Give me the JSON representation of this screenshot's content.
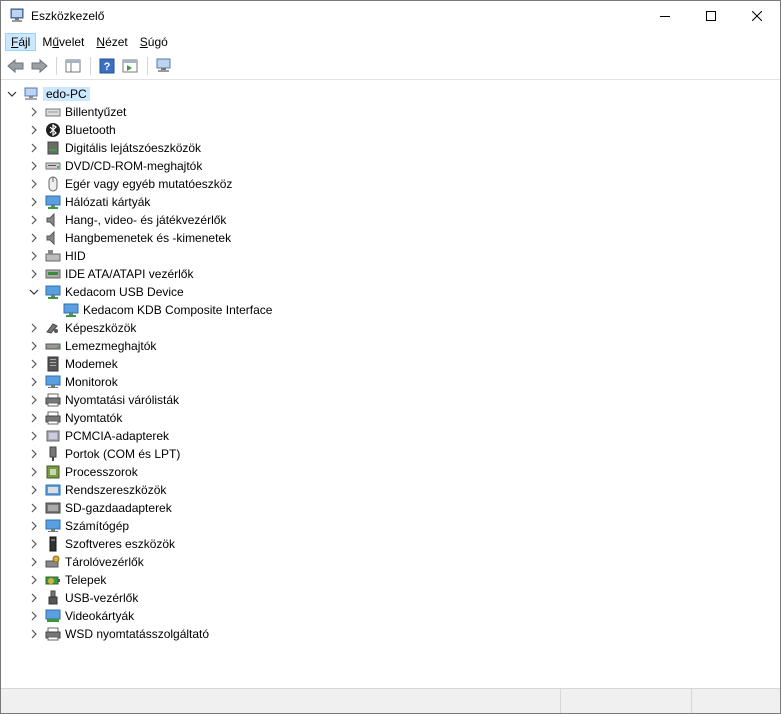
{
  "window": {
    "title": "Eszközkezelő"
  },
  "menu": [
    {
      "label_pre": "",
      "label_u": "F",
      "label_post": "ájl"
    },
    {
      "label_pre": "M",
      "label_u": "ű",
      "label_post": "velet"
    },
    {
      "label_pre": "",
      "label_u": "N",
      "label_post": "ézet"
    },
    {
      "label_pre": "",
      "label_u": "S",
      "label_post": "úgó"
    }
  ],
  "tree": {
    "root": "edo-PC",
    "categories": [
      {
        "label": "Billentyűzet",
        "icon": "keyboard-icon"
      },
      {
        "label": "Bluetooth",
        "icon": "bluetooth-icon"
      },
      {
        "label": "Digitális lejátszóeszközök",
        "icon": "media-player-icon"
      },
      {
        "label": "DVD/CD-ROM-meghajtók",
        "icon": "dvd-drive-icon"
      },
      {
        "label": "Egér vagy egyéb mutatóeszköz",
        "icon": "mouse-icon"
      },
      {
        "label": "Hálózati kártyák",
        "icon": "network-adapter-icon"
      },
      {
        "label": "Hang-, video- és játékvezérlők",
        "icon": "speaker-icon"
      },
      {
        "label": "Hangbemenetek és -kimenetek",
        "icon": "speaker-icon"
      },
      {
        "label": "HID",
        "icon": "hid-icon"
      },
      {
        "label": "IDE ATA/ATAPI vezérlők",
        "icon": "ide-controller-icon"
      },
      {
        "label": "Kedacom USB Device",
        "icon": "usb-device-icon",
        "expanded": true,
        "children": [
          {
            "label": "Kedacom KDB Composite Interface",
            "icon": "usb-device-icon"
          }
        ]
      },
      {
        "label": "Képeszközök",
        "icon": "camera-icon"
      },
      {
        "label": "Lemezmeghajtók",
        "icon": "disk-drive-icon"
      },
      {
        "label": "Modemek",
        "icon": "modem-icon"
      },
      {
        "label": "Monitorok",
        "icon": "monitor-icon"
      },
      {
        "label": "Nyomtatási várólisták",
        "icon": "print-queue-icon"
      },
      {
        "label": "Nyomtatók",
        "icon": "printer-icon"
      },
      {
        "label": "PCMCIA-adapterek",
        "icon": "pcmcia-icon"
      },
      {
        "label": "Portok (COM és LPT)",
        "icon": "port-icon"
      },
      {
        "label": "Processzorok",
        "icon": "processor-icon"
      },
      {
        "label": "Rendszereszközök",
        "icon": "system-device-icon"
      },
      {
        "label": "SD-gazdaadapterek",
        "icon": "sd-host-icon"
      },
      {
        "label": "Számítógép",
        "icon": "computer-icon"
      },
      {
        "label": "Szoftveres eszközök",
        "icon": "software-device-icon"
      },
      {
        "label": "Tárolóvezérlők",
        "icon": "storage-controller-icon"
      },
      {
        "label": "Telepek",
        "icon": "battery-icon"
      },
      {
        "label": "USB-vezérlők",
        "icon": "usb-icon"
      },
      {
        "label": "Videokártyák",
        "icon": "display-adapter-icon"
      },
      {
        "label": "WSD nyomtatásszolgáltató",
        "icon": "wsd-printer-icon"
      }
    ]
  },
  "colors": {
    "selection": "#cce8ff",
    "accent": "#0078d7"
  }
}
